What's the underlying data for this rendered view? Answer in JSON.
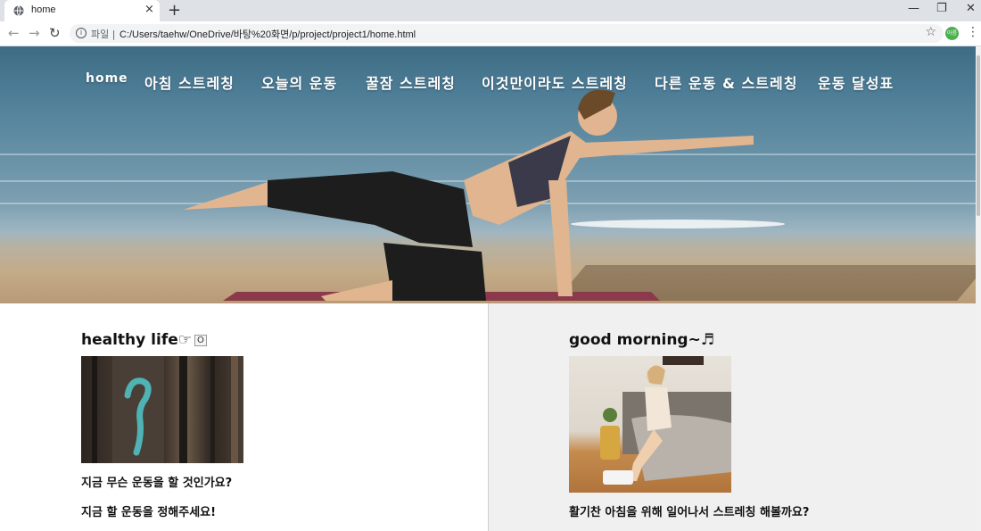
{
  "browser": {
    "tab_title": "home",
    "tab_close": "×",
    "new_tab": "+",
    "scheme_label": "파일 |",
    "url": "C:/Users/taehw/OneDrive/바탕%20화면/p/project/project1/home.html",
    "info_glyph": "i",
    "profile_initials": "아름",
    "icons": [
      "globe-icon",
      "back-arrow-icon",
      "forward-arrow-icon",
      "reload-icon",
      "info-icon",
      "star-icon",
      "menu-icon",
      "minimize-icon",
      "restore-icon",
      "close-icon"
    ]
  },
  "nav": {
    "items": [
      "home",
      "아침 스트레칭",
      "오늘의 운동",
      "꿀잠 스트레칭",
      "이것만이라도 스트레칭",
      "다른 운동 & 스트레칭",
      "운동 달성표"
    ]
  },
  "left": {
    "heading": "healthy life☞",
    "badge": "O",
    "caption1": "지금 무슨 운동을 할 것인가요?",
    "caption2": "지금 할 운동을 정해주세요!"
  },
  "right": {
    "heading": "good morning~♬",
    "caption1": "활기찬 아침을 위해 일어나서 스트레칭 해볼까요?"
  }
}
